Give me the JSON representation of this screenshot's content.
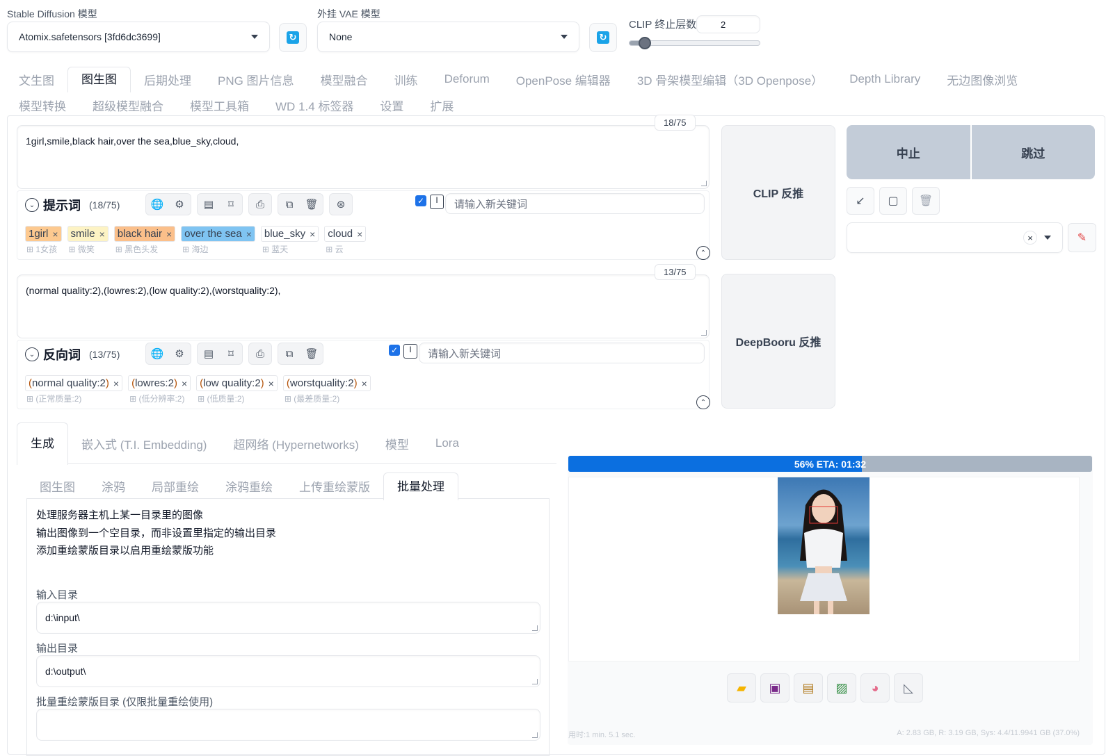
{
  "models": {
    "sd_label": "Stable Diffusion 模型",
    "sd_value": "Atomix.safetensors [3fd6dc3699]",
    "vae_label": "外挂 VAE 模型",
    "vae_value": "None",
    "clip_label": "CLIP 终止层数",
    "clip_value": "2",
    "clip_slider_fraction": 0.12
  },
  "main_tabs_row1": [
    "文生图",
    "图生图",
    "后期处理",
    "PNG 图片信息",
    "模型融合",
    "训练",
    "Deforum",
    "OpenPose 编辑器",
    "3D 骨架模型编辑（3D Openpose）",
    "Depth Library",
    "无边图像浏览"
  ],
  "main_tabs_row2": [
    "模型转换",
    "超级模型融合",
    "模型工具箱",
    "WD 1.4 标签器",
    "设置",
    "扩展"
  ],
  "active_main_tab": "图生图",
  "prompt": {
    "text": "1girl,smile,black hair,over the sea,blue_sky,cloud,",
    "counter": "18/75",
    "label": "提示词",
    "count_label": "(18/75)",
    "keyword_placeholder": "请输入新关键词",
    "chips": [
      {
        "text": "1girl",
        "sub": "1女孩",
        "color": "#fdc98f"
      },
      {
        "text": "smile",
        "sub": "微笑",
        "color": "#fdf3c4"
      },
      {
        "text": "black hair",
        "sub": "黑色头发",
        "color": "#fbbf8a"
      },
      {
        "text": "over the sea",
        "sub": "海边",
        "color": "#7fc4f2"
      },
      {
        "text": "blue_sky",
        "sub": "蓝天",
        "color": "#ffffff"
      },
      {
        "text": "cloud",
        "sub": "云",
        "color": "#ffffff"
      }
    ]
  },
  "negative": {
    "text": "(normal quality:2),(lowres:2),(low quality:2),(worstquality:2),",
    "counter": "13/75",
    "label": "反向词",
    "count_label": "(13/75)",
    "keyword_placeholder": "请输入新关键词",
    "chips": [
      {
        "text": "normal quality:2",
        "sub": "(正常质量:2)"
      },
      {
        "text": "lowres:2",
        "sub": "(低分辨率:2)"
      },
      {
        "text": "low quality:2",
        "sub": "(低质量:2)"
      },
      {
        "text": "worstquality:2",
        "sub": "(最差质量:2)"
      }
    ]
  },
  "interrogate": {
    "clip": "CLIP 反推",
    "deepbooru": "DeepBooru 反推"
  },
  "actions": {
    "stop": "中止",
    "skip": "跳过"
  },
  "sub_tabs": [
    "生成",
    "嵌入式 (T.I. Embedding)",
    "超网络 (Hypernetworks)",
    "模型",
    "Lora"
  ],
  "img2img_tabs": [
    "图生图",
    "涂鸦",
    "局部重绘",
    "涂鸦重绘",
    "上传重绘蒙版",
    "批量处理"
  ],
  "active_img2img_tab": "批量处理",
  "batch": {
    "desc1": "处理服务器主机上某一目录里的图像",
    "desc2": "输出图像到一个空目录，而非设置里指定的输出目录",
    "desc3": "添加重绘蒙版目录以启用重绘蒙版功能",
    "input_label": "输入目录",
    "input_value": "d:\\input\\",
    "output_label": "输出目录",
    "output_value": "d:\\output\\",
    "mask_label": "批量重绘蒙版目录 (仅限批量重绘使用)",
    "mask_value": ""
  },
  "progress": {
    "text": "56% ETA: 01:32",
    "fraction": 0.56
  },
  "footer": {
    "time": "用时:1 min. 5.1 sec.",
    "mem": "A: 2.83 GB, R: 3.19 GB, Sys: 4.4/11.9941 GB (37.0%)"
  },
  "colors": {
    "accent_blue": "#0b6fe0",
    "progress_track": "#a8b4c2",
    "stop_bg": "#c3ccd8"
  }
}
